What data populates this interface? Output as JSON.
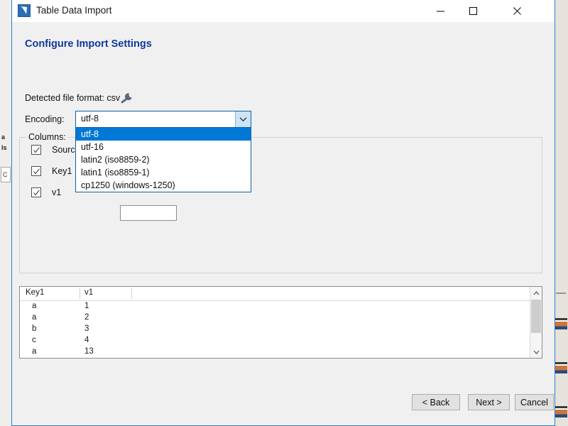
{
  "window": {
    "title": "Table Data Import",
    "icon": "app-icon",
    "controls": {
      "minimize": "minimize-icon",
      "maximize": "maximize-icon",
      "close": "close-icon"
    }
  },
  "page": {
    "heading": "Configure Import Settings",
    "detected_format_label": "Detected file format: csv",
    "settings_icon": "wrench-icon",
    "encoding_label": "Encoding:"
  },
  "encoding_combo": {
    "value": "utf-8",
    "arrow_icon": "chevron-down-icon",
    "expanded": true,
    "options": [
      {
        "label": "utf-8",
        "selected": true
      },
      {
        "label": "utf-16",
        "selected": false
      },
      {
        "label": "latin2 (iso8859-2)",
        "selected": false
      },
      {
        "label": "latin1 (iso8859-1)",
        "selected": false
      },
      {
        "label": "cp1250 (windows-1250)",
        "selected": false
      }
    ]
  },
  "columns_group": {
    "legend": "Columns:",
    "items": [
      {
        "label": "Source C",
        "checked": true
      },
      {
        "label": "Key1",
        "checked": true
      },
      {
        "label": "v1",
        "checked": true
      }
    ]
  },
  "preview": {
    "headers": [
      "Key1",
      "v1",
      ""
    ],
    "rows": [
      [
        "a",
        "1"
      ],
      [
        "a",
        "2"
      ],
      [
        "b",
        "3"
      ],
      [
        "c",
        "4"
      ],
      [
        "a",
        "13"
      ]
    ],
    "scrollbar": {
      "up_icon": "caret-up-icon",
      "down_icon": "caret-down-icon"
    }
  },
  "footer": {
    "back_label": "< Back",
    "next_label": "Next >",
    "cancel_label": "Cancel"
  },
  "background": {
    "left_fragments": [
      "a",
      "ls"
    ],
    "left_box_text": "C"
  },
  "colors": {
    "accent": "#0078d7",
    "heading": "#113a9c",
    "window_border": "#2a7fd4",
    "dialog_bg": "#f0f0f0",
    "combo_border": "#0f5fa6"
  }
}
